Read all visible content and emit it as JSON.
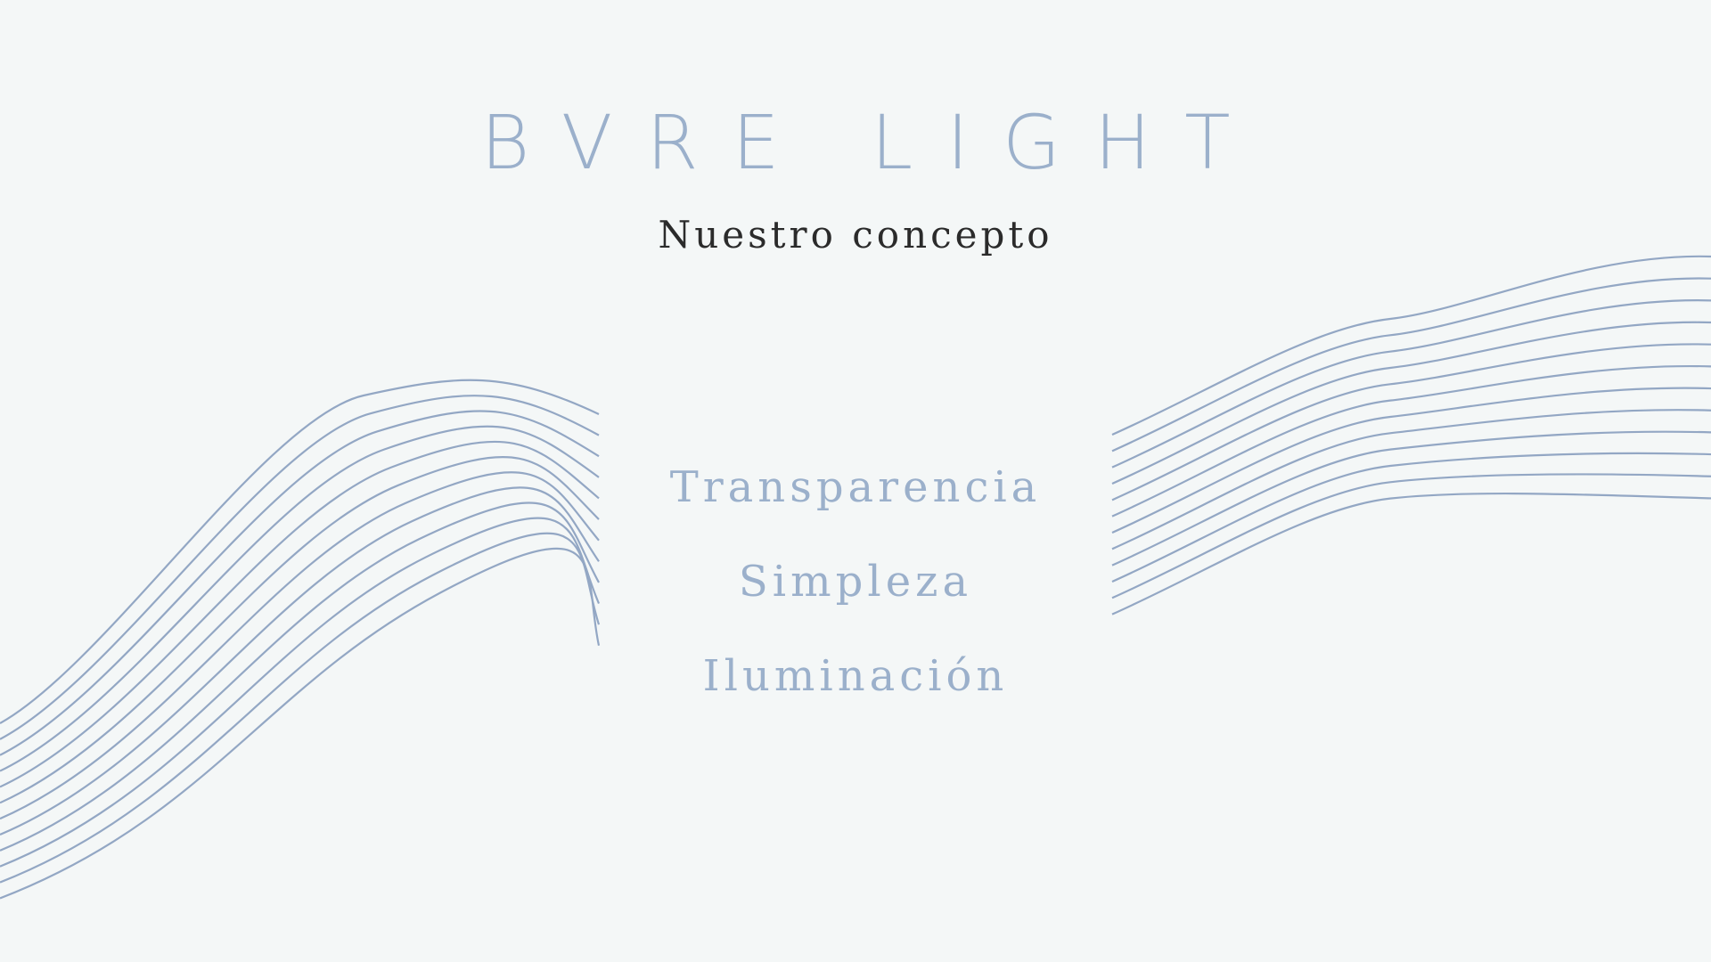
{
  "slide": {
    "brand_title": "BVRE LIGHT",
    "subtitle": "Nuestro concepto",
    "concepts": [
      {
        "label": "Transparencia"
      },
      {
        "label": "Simpleza"
      },
      {
        "label": "Iluminación"
      }
    ],
    "colors": {
      "background": "#f4f7f7",
      "accent": "#9bb0cb",
      "line": "#93a7c4",
      "subtitle": "#2b2b2b"
    }
  }
}
